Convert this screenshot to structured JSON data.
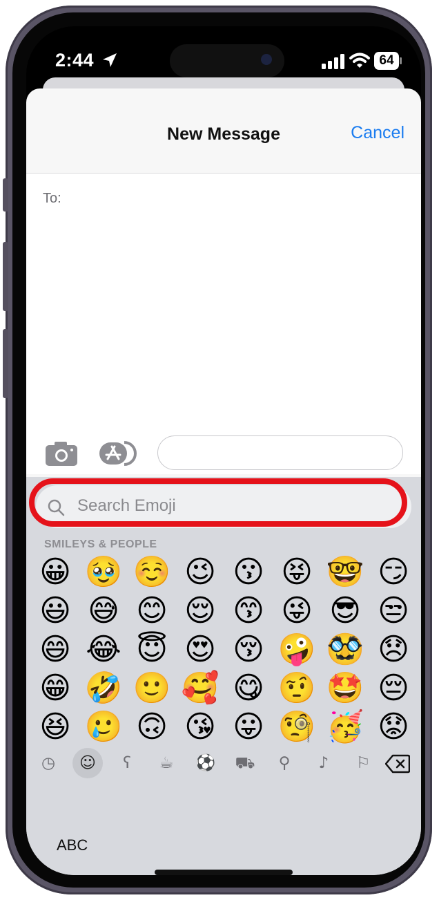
{
  "status_bar": {
    "time": "2:44",
    "battery": "64"
  },
  "header": {
    "title": "New Message",
    "cancel_label": "Cancel"
  },
  "recipient": {
    "to_label": "To:"
  },
  "composer": {
    "message_placeholder": ""
  },
  "emoji_keyboard": {
    "search_placeholder": "Search Emoji",
    "category_title": "SMILEYS & PEOPLE",
    "columns": [
      [
        "😀",
        "😃",
        "😄",
        "😁",
        "😆"
      ],
      [
        "🥹",
        "😅",
        "😂",
        "🤣",
        "🥲"
      ],
      [
        "☺️",
        "😊",
        "😇",
        "🙂",
        "🙃"
      ],
      [
        "😉",
        "😌",
        "😍",
        "🥰",
        "😘"
      ],
      [
        "😗",
        "😙",
        "😚",
        "😋",
        "😛"
      ],
      [
        "😝",
        "😜",
        "🤪",
        "🤨",
        "🧐"
      ],
      [
        "🤓",
        "😎",
        "🥸",
        "🤩",
        "🥳"
      ],
      [
        "😏",
        "😒",
        "😞",
        "😔",
        "😟"
      ]
    ],
    "categories": [
      {
        "name": "recent",
        "glyph": "◷"
      },
      {
        "name": "smileys",
        "glyph": "☺"
      },
      {
        "name": "animals",
        "glyph": "ʕ"
      },
      {
        "name": "food",
        "glyph": "☕"
      },
      {
        "name": "activity",
        "glyph": "⚽"
      },
      {
        "name": "travel",
        "glyph": "⛟"
      },
      {
        "name": "objects",
        "glyph": "⚲"
      },
      {
        "name": "symbols",
        "glyph": "♪"
      },
      {
        "name": "flags",
        "glyph": "⚐"
      }
    ],
    "active_category": "smileys",
    "abc_label": "ABC"
  },
  "colors": {
    "accent": "#1a7cf0",
    "highlight_ring": "#e5121a"
  }
}
